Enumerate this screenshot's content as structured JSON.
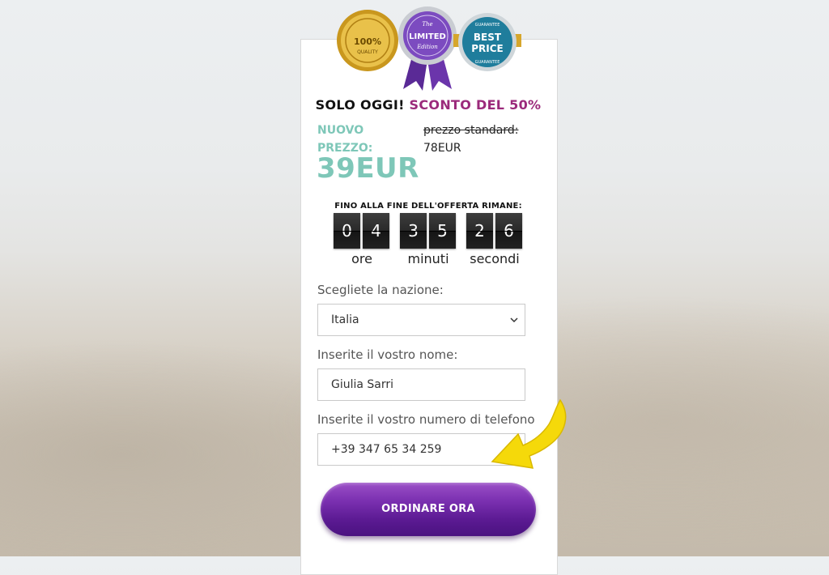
{
  "badges": {
    "quality": {
      "line1": "100%",
      "line2": "QUALITY"
    },
    "limited": {
      "line1": "The",
      "line2": "LIMITED",
      "line3": "Edition"
    },
    "best_price": {
      "top": "GUARANTEE",
      "line1": "BEST",
      "line2": "PRICE",
      "bottom": "GUARANTEE"
    }
  },
  "offer": {
    "headline_prefix": "SOLO OGGI!",
    "headline_accent": "SCONTO DEL 50%",
    "new_price_label_1": "NUOVO",
    "new_price_label_2": "PREZZO:",
    "new_price_value": "39EUR",
    "old_price_label": "prezzo standard:",
    "old_price_value": "78EUR"
  },
  "timer": {
    "title": "FINO ALLA FINE DELL'OFFERTA RIMANE:",
    "hours": [
      "0",
      "4"
    ],
    "minutes": [
      "3",
      "5"
    ],
    "seconds": [
      "2",
      "6"
    ],
    "hours_label": "ore",
    "minutes_label": "minuti",
    "seconds_label": "secondi"
  },
  "form": {
    "country_label": "Scegliete la nazione:",
    "country_value": "Italia",
    "name_label": "Inserite il vostro nome:",
    "name_value": "Giulia Sarri",
    "phone_label": "Inserite il vostro numero di telefono",
    "phone_value": "+39 347 65 34 259",
    "submit_label": "ORDINARE ORA"
  },
  "colors": {
    "accent_purple": "#9b2a7b",
    "price_teal": "#7ec7b8",
    "button_purple": "#5b1a92",
    "arrow_yellow": "#f5d90a"
  }
}
